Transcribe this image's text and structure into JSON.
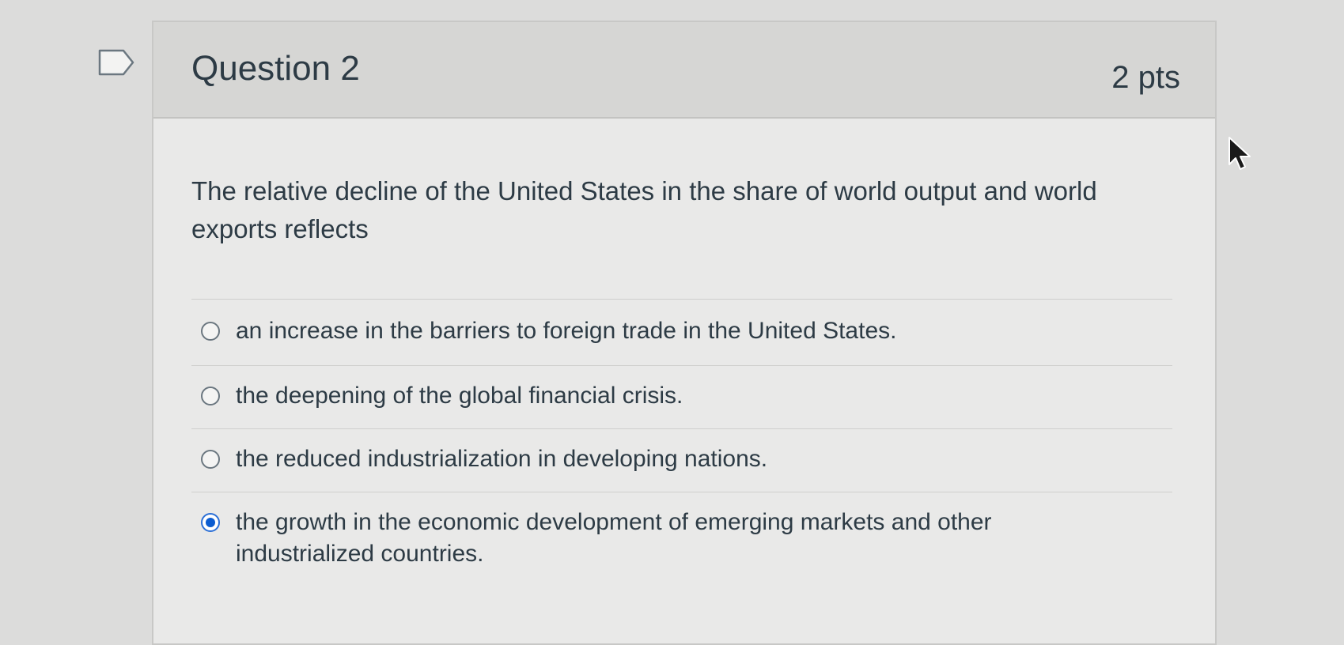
{
  "question": {
    "title": "Question 2",
    "points": "2 pts",
    "text": "The relative decline of the United States in the share of world output and world exports reflects"
  },
  "answers": [
    {
      "label": "an increase in the barriers to foreign trade in the United States.",
      "selected": false
    },
    {
      "label": "the deepening of the global financial crisis.",
      "selected": false
    },
    {
      "label": "the reduced industrialization in developing nations.",
      "selected": false
    },
    {
      "label": "the growth in the economic development of emerging markets and other industrialized countries.",
      "selected": true
    }
  ],
  "icons": {
    "flag": "flag-icon",
    "cursor": "mouse-cursor-icon"
  },
  "colors": {
    "selected_radio": "#0b5cd0",
    "text": "#2d3b45"
  }
}
